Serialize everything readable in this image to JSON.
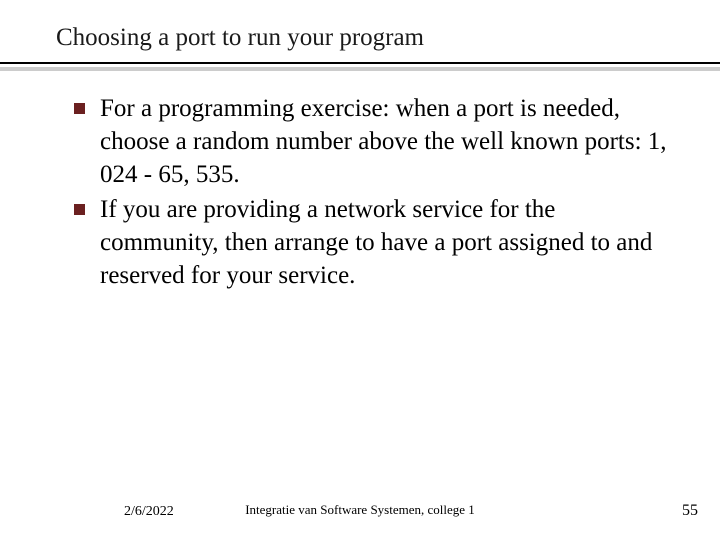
{
  "title": "Choosing a port to run your program",
  "bullets": [
    "For a programming exercise: when a port is needed, choose a random number above the well known ports: 1, 024 - 65, 535.",
    "If you are providing a network service for the community, then arrange to have a port assigned to and reserved for your service."
  ],
  "footer": {
    "date": "2/6/2022",
    "center": "Integratie van Software Systemen, college 1",
    "page": "55"
  },
  "colors": {
    "bullet": "#6b2020"
  }
}
